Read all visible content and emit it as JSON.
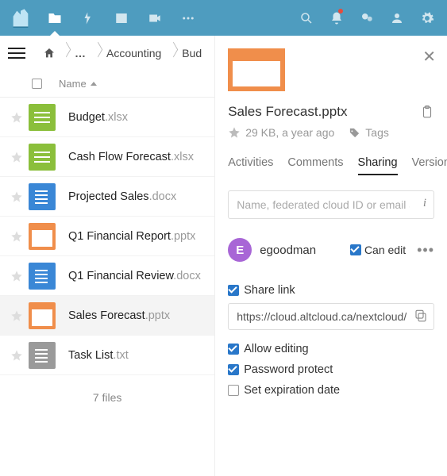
{
  "breadcrumbs": {
    "home": "home",
    "dots": "…",
    "c1": "Accounting",
    "c2": "Bud"
  },
  "listHeader": {
    "name": "Name"
  },
  "files": [
    {
      "name": "Budget",
      "ext": ".xlsx",
      "type": "xlsx"
    },
    {
      "name": "Cash Flow Forecast",
      "ext": ".xlsx",
      "type": "xlsx"
    },
    {
      "name": "Projected Sales",
      "ext": ".docx",
      "type": "docx"
    },
    {
      "name": "Q1 Financial Report",
      "ext": ".pptx",
      "type": "pptx"
    },
    {
      "name": "Q1 Financial Review",
      "ext": ".docx",
      "type": "docx"
    },
    {
      "name": "Sales Forecast",
      "ext": ".pptx",
      "type": "pptx",
      "selected": true
    },
    {
      "name": "Task List",
      "ext": ".txt",
      "type": "txt"
    }
  ],
  "footer": "7 files",
  "panel": {
    "title": "Sales Forecast.pptx",
    "meta": "29 KB, a year ago",
    "tagsLabel": "Tags",
    "tabs": {
      "activities": "Activities",
      "comments": "Comments",
      "sharing": "Sharing",
      "versions": "Versions"
    },
    "sharePlaceholder": "Name, federated cloud ID or email address",
    "sharee": {
      "initial": "E",
      "name": "egoodman",
      "canEdit": "Can edit"
    },
    "shareLinkLabel": "Share link",
    "linkValue": "https://cloud.altcloud.ca/nextcloud/i…",
    "allowEditing": "Allow editing",
    "passwordProtect": "Password protect",
    "setExpiration": "Set expiration date"
  }
}
